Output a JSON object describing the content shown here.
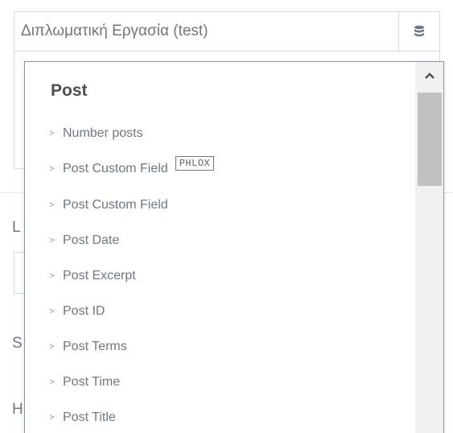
{
  "title_field": {
    "value": "Διπλωματική Εργασία (test)",
    "dynamic_tags_icon": "database-icon"
  },
  "background_labels": [
    "L",
    "S",
    "H"
  ],
  "dropdown": {
    "group_title": "Post",
    "options": [
      {
        "label": "Number posts",
        "badge": ""
      },
      {
        "label": "Post Custom Field",
        "badge": "PHLOX"
      },
      {
        "label": "Post Custom Field",
        "badge": ""
      },
      {
        "label": "Post Date",
        "badge": ""
      },
      {
        "label": "Post Excerpt",
        "badge": ""
      },
      {
        "label": "Post ID",
        "badge": ""
      },
      {
        "label": "Post Terms",
        "badge": ""
      },
      {
        "label": "Post Time",
        "badge": ""
      },
      {
        "label": "Post Title",
        "badge": ""
      }
    ],
    "scroll_up_icon": "chevron-up-icon"
  }
}
